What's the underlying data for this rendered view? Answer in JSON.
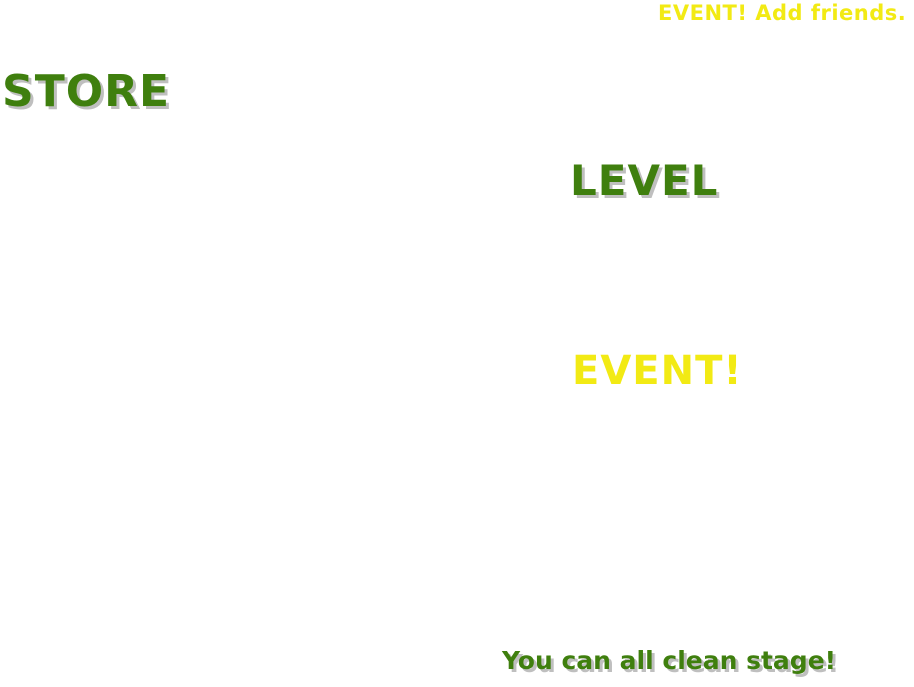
{
  "event_banner": {
    "text": "EVENT! Add friends."
  },
  "store_button": {
    "label": "STORE"
  },
  "level_button": {
    "label": "LEVEL"
  },
  "event_button": {
    "label": "EVENT!"
  },
  "footer_message": {
    "text": "You can all clean stage!"
  },
  "colors": {
    "green_text": "#3f7f0e",
    "yellow_text": "#f2ea14",
    "text_shadow": "#bfbfbf",
    "background": "#ffffff"
  }
}
